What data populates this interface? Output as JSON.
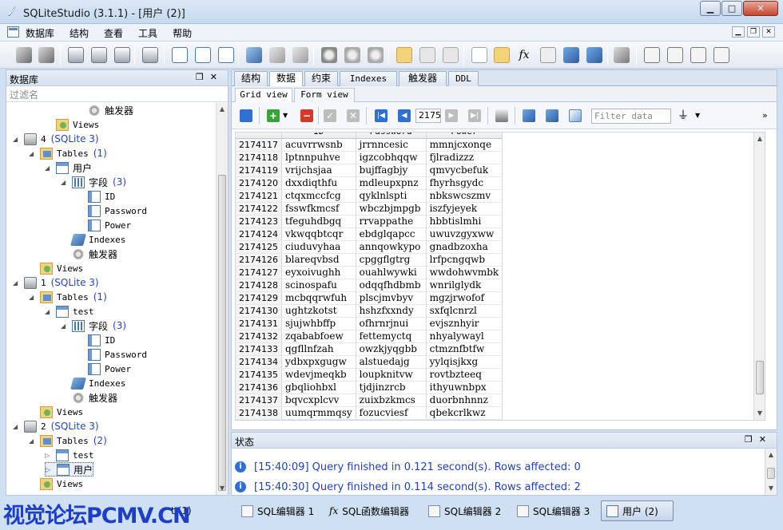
{
  "window": {
    "title": "SQLiteStudio (3.1.1) - [用户 (2)]"
  },
  "menu": [
    "数据库",
    "结构",
    "查看",
    "工具",
    "帮助"
  ],
  "left_panel": {
    "title": "数据库",
    "filter_placeholder": "过滤名"
  },
  "tree": [
    {
      "label": "触发器",
      "icon": "trigger-icon",
      "level": 4,
      "arrow": ""
    },
    {
      "label": "Views",
      "icon": "views-icon",
      "level": 2,
      "arrow": "",
      "mono": true
    },
    {
      "label": "4",
      "suffix": "(SQLite 3)",
      "icon": "database-icon",
      "level": 0,
      "arrow": "◢",
      "mono": true
    },
    {
      "label": "Tables",
      "suffix": "(1)",
      "icon": "tables-folder-icon",
      "level": 1,
      "arrow": "◢",
      "mono": true
    },
    {
      "label": "用户",
      "icon": "table-icon",
      "level": 2,
      "arrow": "◢"
    },
    {
      "label": "字段",
      "suffix": "(3)",
      "icon": "columns-icon",
      "level": 3,
      "arrow": "◢"
    },
    {
      "label": "ID",
      "icon": "column-icon",
      "level": 4,
      "arrow": "",
      "mono": true
    },
    {
      "label": "Password",
      "icon": "column-icon",
      "level": 4,
      "arrow": "",
      "mono": true
    },
    {
      "label": "Power",
      "icon": "column-icon",
      "level": 4,
      "arrow": "",
      "mono": true
    },
    {
      "label": "Indexes",
      "icon": "indexes-icon",
      "level": 3,
      "arrow": "",
      "mono": true
    },
    {
      "label": "触发器",
      "icon": "trigger-icon",
      "level": 3,
      "arrow": ""
    },
    {
      "label": "Views",
      "icon": "views-icon",
      "level": 1,
      "arrow": "",
      "mono": true
    },
    {
      "label": "1",
      "suffix": "(SQLite 3)",
      "icon": "database-icon",
      "level": 0,
      "arrow": "◢",
      "mono": true
    },
    {
      "label": "Tables",
      "suffix": "(1)",
      "icon": "tables-folder-icon",
      "level": 1,
      "arrow": "◢",
      "mono": true
    },
    {
      "label": "test",
      "icon": "table-icon",
      "level": 2,
      "arrow": "◢",
      "mono": true
    },
    {
      "label": "字段",
      "suffix": "(3)",
      "icon": "columns-icon",
      "level": 3,
      "arrow": "◢"
    },
    {
      "label": "ID",
      "icon": "column-icon",
      "level": 4,
      "arrow": "",
      "mono": true
    },
    {
      "label": "Password",
      "icon": "column-icon",
      "level": 4,
      "arrow": "",
      "mono": true
    },
    {
      "label": "Power",
      "icon": "column-icon",
      "level": 4,
      "arrow": "",
      "mono": true
    },
    {
      "label": "Indexes",
      "icon": "indexes-icon",
      "level": 3,
      "arrow": "",
      "mono": true
    },
    {
      "label": "触发器",
      "icon": "trigger-icon",
      "level": 3,
      "arrow": ""
    },
    {
      "label": "Views",
      "icon": "views-icon",
      "level": 1,
      "arrow": "",
      "mono": true
    },
    {
      "label": "2",
      "suffix": "(SQLite 3)",
      "icon": "database-icon",
      "level": 0,
      "arrow": "◢",
      "mono": true
    },
    {
      "label": "Tables",
      "suffix": "(2)",
      "icon": "tables-folder-icon",
      "level": 1,
      "arrow": "◢",
      "mono": true
    },
    {
      "label": "test",
      "icon": "table-icon",
      "level": 2,
      "arrow": "▷",
      "mono": true
    },
    {
      "label": "用户",
      "icon": "table-icon",
      "level": 2,
      "arrow": "▷",
      "selected": true
    },
    {
      "label": "Views",
      "icon": "views-icon",
      "level": 1,
      "arrow": "",
      "mono": true
    }
  ],
  "tabs": [
    "结构",
    "数据",
    "约束",
    "Indexes",
    "触发器",
    "DDL"
  ],
  "active_tab": "数据",
  "subtabs": [
    "Grid view",
    "Form view"
  ],
  "grid_toolbar": {
    "page": "2175",
    "filter_placeholder": "Filter data"
  },
  "grid": {
    "columns": [
      "ID",
      "Password",
      "Power"
    ],
    "rows": [
      [
        "2174117",
        "acuvrrwsnb",
        "jrrnncesic",
        "mmnjcxonqe"
      ],
      [
        "2174118",
        "lptnnpuhve",
        "igzcobhqqw",
        "fjlradizzz"
      ],
      [
        "2174119",
        "vrijchsjaa",
        "bujffagbjy",
        "qmvycbefuk"
      ],
      [
        "2174120",
        "dxxdiqthfu",
        "mdleupxpnz",
        "fhyrhsgydc"
      ],
      [
        "2174121",
        "ctqxmccfcg",
        "qyklnlspti",
        "nbkswcszmv"
      ],
      [
        "2174122",
        "fsswfkmcsf",
        "wbczbjmpgb",
        "iszfyjeyek"
      ],
      [
        "2174123",
        "tfeguhdbgq",
        "rrvappathe",
        "hbbtislmhi"
      ],
      [
        "2174124",
        "vkwqqbtcqr",
        "ebdglqapcc",
        "uwuvzgyxww"
      ],
      [
        "2174125",
        "ciuduvyhaa",
        "annqowkypo",
        "gnadbzoxha"
      ],
      [
        "2174126",
        "blareqvbsd",
        "cpggflgtrg",
        "lrfpcngqwb"
      ],
      [
        "2174127",
        "eyxoivughh",
        "ouahlwywki",
        "wwdohwvmbk"
      ],
      [
        "2174128",
        "scinospafu",
        "odqqfhdbmb",
        "wnrilglydk"
      ],
      [
        "2174129",
        "mcbqqrwfuh",
        "plscjmvbyv",
        "mgzjrwofof"
      ],
      [
        "2174130",
        "ughtzkotst",
        "hshzfxxndy",
        "sxfqlcnrzl"
      ],
      [
        "2174131",
        "sjujwhbffp",
        "ofhrnrjnui",
        "evjsznhyir"
      ],
      [
        "2174132",
        "zqababfoew",
        "fettemyctq",
        "nhyalywayl"
      ],
      [
        "2174133",
        "qgfllnfzah",
        "owzkjyqgbb",
        "ctmznfbtfw"
      ],
      [
        "2174134",
        "ydbxpxgugw",
        "alstuedajg",
        "yylqisjkxg"
      ],
      [
        "2174135",
        "wdevjmeqkb",
        "loupknitvw",
        "rovtbzteeq"
      ],
      [
        "2174136",
        "gbqliohbxl",
        "tjdjinzrcb",
        "ithyuwnbpx"
      ],
      [
        "2174137",
        "bqvcxplcvv",
        "zuixbzkmcs",
        "duorbnhnnz"
      ],
      [
        "2174138",
        "uumqrmmqsy",
        "fozucviesf",
        "qbekcrlkwz"
      ]
    ]
  },
  "status": {
    "title": "状态",
    "messages": [
      "[15:40:09] Query finished in 0.121 second(s). Rows affected: 0",
      "[15:40:30] Query finished in 0.114 second(s). Rows affected: 2"
    ]
  },
  "taskbar": [
    {
      "label": "t  (1)",
      "partial": true
    },
    {
      "label": "SQL编辑器 1"
    },
    {
      "label": "SQL函数编辑器"
    },
    {
      "label": "SQL编辑器 2"
    },
    {
      "label": "SQL编辑器 3"
    },
    {
      "label": "用户 (2)",
      "active": true
    }
  ],
  "watermark": "视觉论坛PCMV.CN"
}
